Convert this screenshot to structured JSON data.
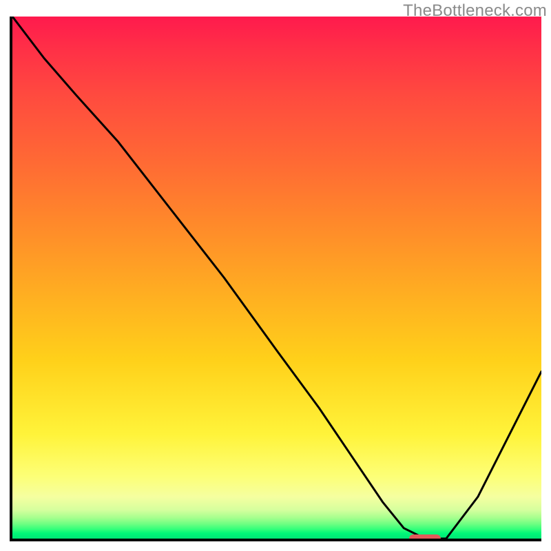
{
  "watermark": "TheBottleneck.com",
  "chart_data": {
    "type": "line",
    "title": "",
    "xlabel": "",
    "ylabel": "",
    "x_range": [
      0,
      100
    ],
    "y_range": [
      0,
      100
    ],
    "grid": false,
    "legend": false,
    "background_gradient": {
      "direction": "vertical",
      "stops": [
        {
          "pos": 0,
          "color": "#ff1a4d"
        },
        {
          "pos": 28,
          "color": "#ff6a34"
        },
        {
          "pos": 52,
          "color": "#ffab22"
        },
        {
          "pos": 80,
          "color": "#fff33a"
        },
        {
          "pos": 92,
          "color": "#f5ffa0"
        },
        {
          "pos": 96,
          "color": "#a6ff8e"
        },
        {
          "pos": 100,
          "color": "#00e676"
        }
      ]
    },
    "series": [
      {
        "name": "bottleneck-curve",
        "color": "#000000",
        "stroke_width": 3,
        "x": [
          0,
          6,
          12,
          20,
          30,
          40,
          50,
          58,
          64,
          70,
          74,
          78,
          82,
          88,
          94,
          100
        ],
        "y": [
          100,
          92,
          85,
          76,
          63,
          50,
          36,
          25,
          16,
          7,
          2,
          0,
          0,
          8,
          20,
          32
        ]
      }
    ],
    "marker": {
      "name": "optimal-point",
      "x": 78,
      "y": 0,
      "width_x_units": 6,
      "color": "#e15a5a"
    }
  }
}
